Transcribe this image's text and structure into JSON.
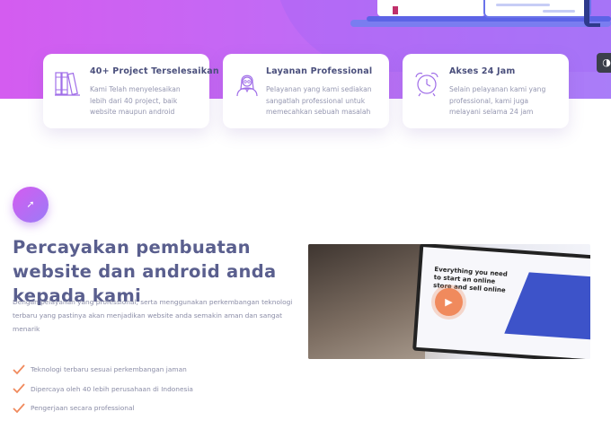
{
  "cards": [
    {
      "title": "40+ Project Terselesaikan",
      "desc": "Kami Telah menyelesaikan lebih dari 40 project, baik website maupun android",
      "icon": "books-icon"
    },
    {
      "title": "Layanan Professional",
      "desc": "Pelayanan yang kami sediakan sangatlah professional untuk memecahkan sebuah masalah",
      "icon": "professional-woman-icon"
    },
    {
      "title": "Akses 24 Jam",
      "desc": "Selain pelayanan kami yang professional, kami juga melayani selama 24 jam",
      "icon": "alarm-clock-icon"
    }
  ],
  "about": {
    "headline": "Percayakan pembuatan website dan android anda kepada kami",
    "lead": "Dengan pelayanan yang professional, serta menggunakan perkembangan teknologi terbaru yang pastinya akan menjadikan website anda semakin aman dan sangat menarik",
    "features": [
      "Teknologi terbaru sesuai perkembangan jaman",
      "Dipercaya oleh 40 lebih perusahaan di Indonesia",
      "Pengerjaan secara professional"
    ]
  },
  "video": {
    "screen_text": "Everything you need to start an online store and sell online"
  },
  "colors": {
    "hero_start": "#d45cf0",
    "hero_end": "#a97df8",
    "heading": "#5a5f8e",
    "check": "#f08a5d",
    "play": "#f08a5d"
  },
  "icons": {
    "dark_mode": "moon-icon",
    "bubble": "trend-arrow-icon",
    "play": "play-icon",
    "check": "check-icon"
  }
}
